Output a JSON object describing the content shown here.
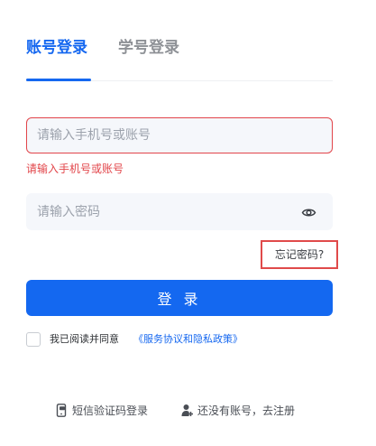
{
  "tabs": {
    "account_label": "账号登录",
    "student_label": "学号登录"
  },
  "account_field": {
    "placeholder": "请输入手机号或账号",
    "value": "",
    "error": "请输入手机号或账号"
  },
  "password_field": {
    "placeholder": "请输入密码",
    "value": "",
    "toggle_icon": "eye-icon"
  },
  "forgot_label": "忘记密码?",
  "login_label": "登 录",
  "agreement": {
    "checked": false,
    "text": "我已阅读并同意",
    "link_text": "《服务协议和隐私政策》"
  },
  "bottom_links": {
    "sms_label": "短信验证码登录",
    "sms_icon": "phone-icon",
    "register_label": "还没有账号，去注册",
    "register_icon": "user-add-icon"
  },
  "colors": {
    "accent": "#1668f0",
    "error": "#e2454a"
  }
}
